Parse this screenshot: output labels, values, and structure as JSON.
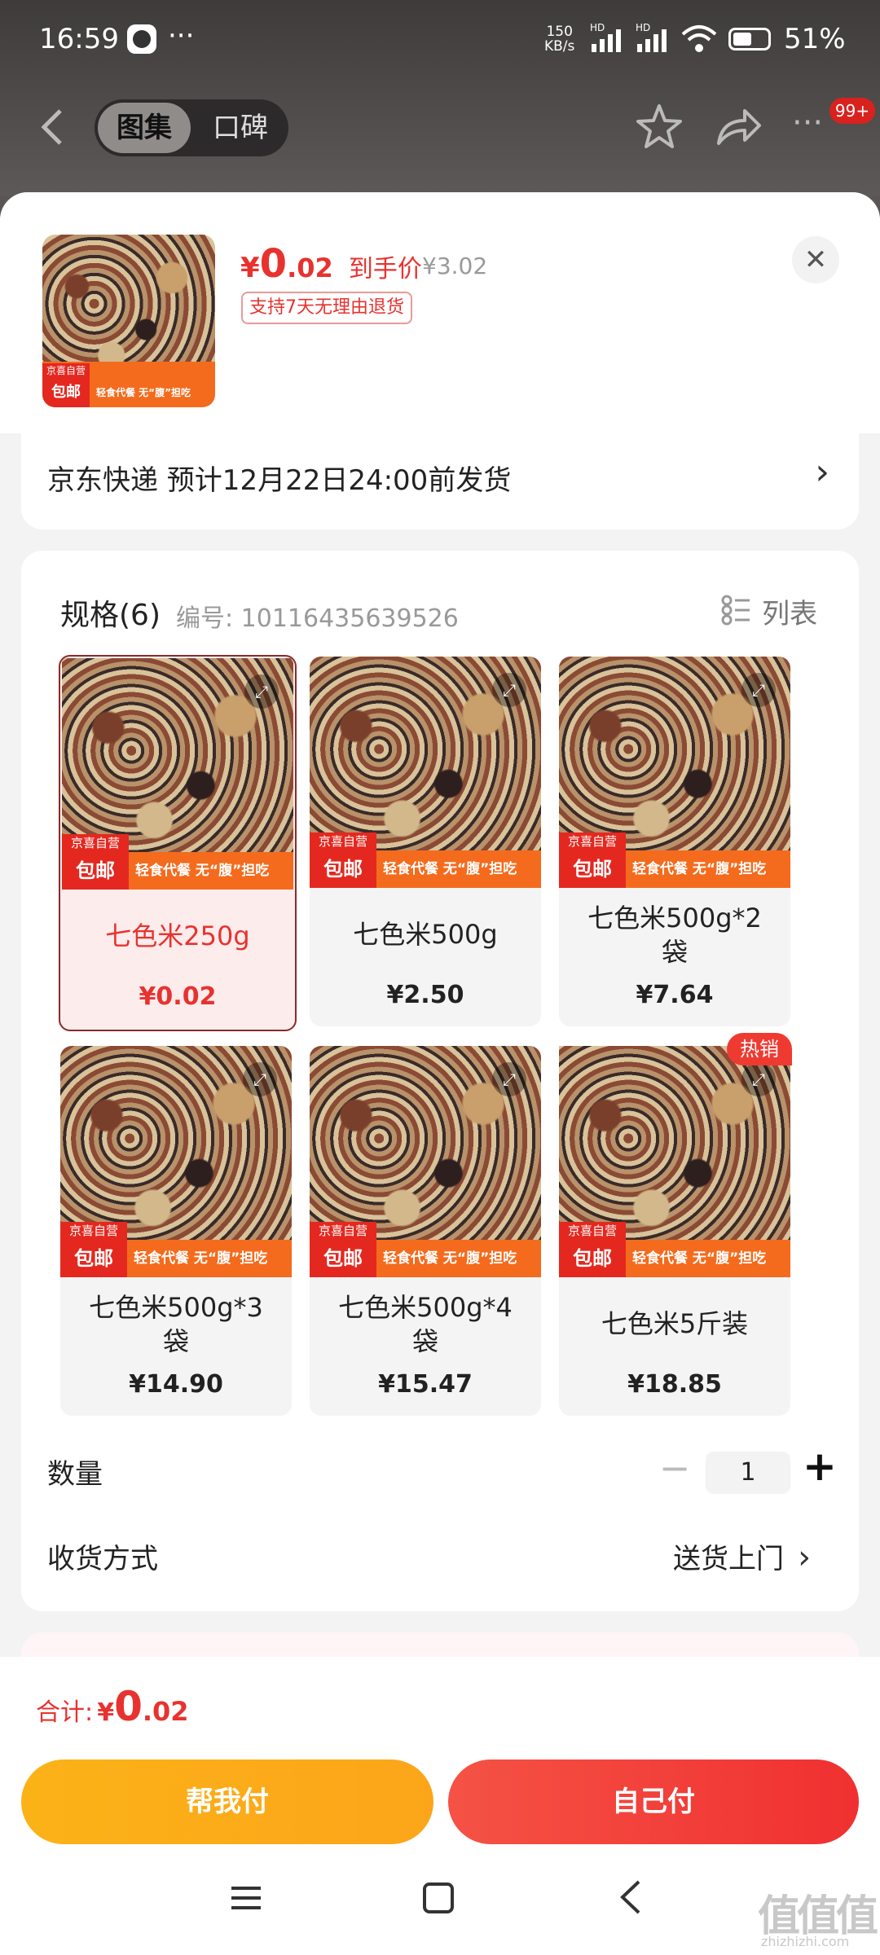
{
  "status_bar": {
    "time": "16:59",
    "more": "···",
    "net_speed_top": "150",
    "net_speed_bottom": "KB/s",
    "hd1": "HD",
    "hd2": "HD",
    "battery": "51%"
  },
  "top_nav": {
    "tab_gallery": "图集",
    "tab_reviews": "口碑",
    "badge": "99+"
  },
  "product": {
    "price_symbol": "¥",
    "price_big": "0",
    "price_small": ".02",
    "price_label": "到手价",
    "original_price": "¥3.02",
    "return_tag": "支持7天无理由退货",
    "thumb_self_tag": "京喜自营",
    "thumb_free_ship": "包邮",
    "thumb_slogan": "轻食代餐 无“腹”担吃"
  },
  "shipping": {
    "text": "京东快递 预计12月22日24:00前发货",
    "arrow": "›"
  },
  "specs": {
    "title": "规格(6)",
    "code_label": "编号: 10116435639526",
    "list_label": "列表",
    "items": [
      {
        "name_line1": "七色米250g",
        "name_line2": "",
        "price": "¥0.02"
      },
      {
        "name_line1": "七色米500g",
        "name_line2": "",
        "price": "¥2.50"
      },
      {
        "name_line1": "七色米500g*2",
        "name_line2": "袋",
        "price": "¥7.64"
      },
      {
        "name_line1": "七色米500g*3",
        "name_line2": "袋",
        "price": "¥14.90"
      },
      {
        "name_line1": "七色米500g*4",
        "name_line2": "袋",
        "price": "¥15.47"
      },
      {
        "name_line1": "七色米5斤装",
        "name_line2": "",
        "price": "¥18.85",
        "badge": "热销"
      }
    ]
  },
  "quantity": {
    "label": "数量",
    "minus": "−",
    "value": "1",
    "plus": "+"
  },
  "delivery": {
    "label": "收货方式",
    "value": "送货上门",
    "arrow": "›"
  },
  "footer": {
    "total_label": "合计:",
    "total_symbol": "¥",
    "total_big": "0",
    "total_small": ".02",
    "btn_help_pay": "帮我付",
    "btn_self_pay": "自己付"
  },
  "watermark": "值值值",
  "watermark_url": "zhizhizhi.com",
  "colors": {
    "accent_red": "#e8322f",
    "orange_button": "#fbb217",
    "red_button": "#f33a3a"
  }
}
